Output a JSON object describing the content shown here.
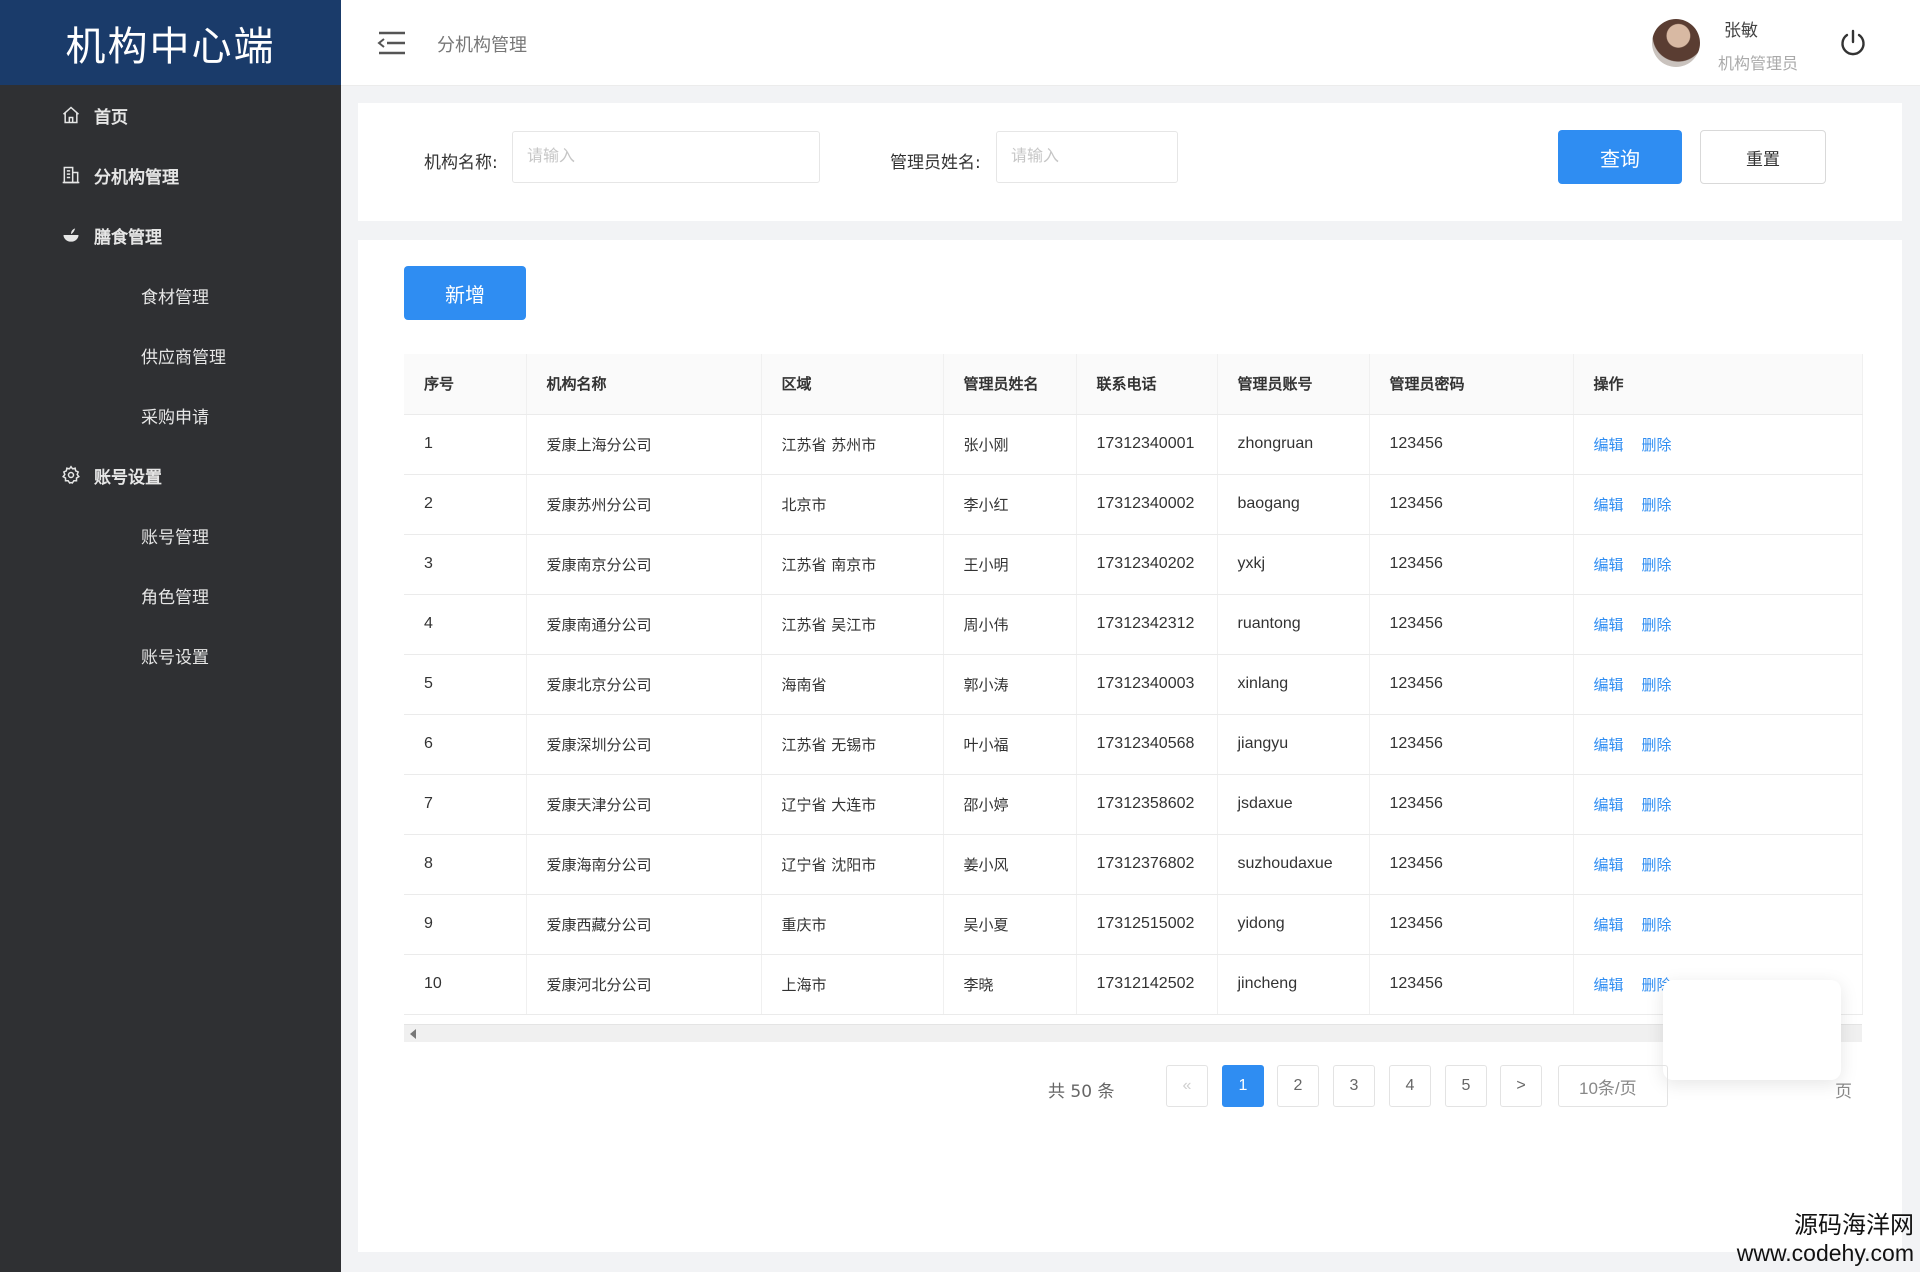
{
  "sidebar": {
    "brand": "机构中心端",
    "items": [
      {
        "label": "首页",
        "icon": "home-icon"
      },
      {
        "label": "分机构管理",
        "icon": "building-icon"
      },
      {
        "label": "膳食管理",
        "icon": "food-icon"
      },
      {
        "label": "食材管理"
      },
      {
        "label": "供应商管理"
      },
      {
        "label": "采购申请"
      },
      {
        "label": "账号设置",
        "icon": "gear-icon"
      },
      {
        "label": "账号管理"
      },
      {
        "label": "角色管理"
      },
      {
        "label": "账号设置"
      }
    ]
  },
  "header": {
    "breadcrumb": "分机构管理",
    "user_name": "张敏",
    "user_role": "机构管理员"
  },
  "search": {
    "org_label": "机构名称:",
    "org_placeholder": "请输入",
    "admin_label": "管理员姓名:",
    "admin_placeholder": "请输入",
    "query_label": "查询",
    "reset_label": "重置"
  },
  "toolbar": {
    "add_label": "新增"
  },
  "table": {
    "headers": [
      "序号",
      "机构名称",
      "区域",
      "管理员姓名",
      "联系电话",
      "管理员账号",
      "管理员密码",
      "操作"
    ],
    "edit_label": "编辑",
    "delete_label": "删除",
    "rows": [
      [
        "1",
        "爱康上海分公司",
        "江苏省 苏州市",
        "张小刚",
        "17312340001",
        "zhongruan",
        "123456"
      ],
      [
        "2",
        "爱康苏州分公司",
        "北京市",
        "李小红",
        "17312340002",
        "baogang",
        "123456"
      ],
      [
        "3",
        "爱康南京分公司",
        "江苏省 南京市",
        "王小明",
        "17312340202",
        "yxkj",
        "123456"
      ],
      [
        "4",
        "爱康南通分公司",
        "江苏省 吴江市",
        "周小伟",
        "17312342312",
        "ruantong",
        "123456"
      ],
      [
        "5",
        "爱康北京分公司",
        "海南省",
        "郭小涛",
        "17312340003",
        "xinlang",
        "123456"
      ],
      [
        "6",
        "爱康深圳分公司",
        "江苏省 无锡市",
        "叶小福",
        "17312340568",
        "jiangyu",
        "123456"
      ],
      [
        "7",
        "爱康天津分公司",
        "辽宁省 大连市",
        "邵小婷",
        "17312358602",
        "jsdaxue",
        "123456"
      ],
      [
        "8",
        "爱康海南分公司",
        "辽宁省 沈阳市",
        "姜小风",
        "17312376802",
        "suzhoudaxue",
        "123456"
      ],
      [
        "9",
        "爱康西藏分公司",
        "重庆市",
        "吴小夏",
        "17312515002",
        "yidong",
        "123456"
      ],
      [
        "10",
        "爱康河北分公司",
        "上海市",
        "李晓",
        "17312142502",
        "jincheng",
        "123456"
      ]
    ]
  },
  "pagination": {
    "total": "共 50 条",
    "prev": "«",
    "pages": [
      "1",
      "2",
      "3",
      "4",
      "5"
    ],
    "current": "1",
    "next": ">",
    "page_size": "10条/页",
    "goto_tail": "页"
  },
  "watermark": {
    "line1": "源码海洋网",
    "line2": "www.codehy.com"
  },
  "colors": {
    "sidebar_bg": "#2f3033",
    "brand_bg": "#1a3b6a",
    "accent": "#2f8df2"
  }
}
